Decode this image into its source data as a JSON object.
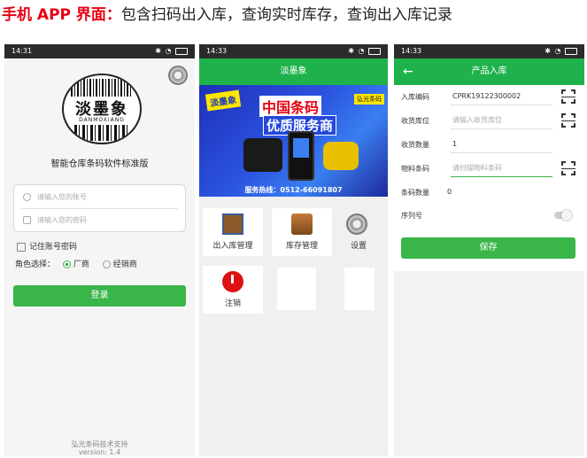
{
  "heading": {
    "prefix": "手机 APP 界面：",
    "text": "包含扫码出入库，查询实时库存，查询出入库记录"
  },
  "colors": {
    "accent_green": "#3ab54a",
    "title_green": "#1fb24c",
    "heading_red": "#e60012"
  },
  "phone1": {
    "status_time": "14:31",
    "logo_text": "淡墨象",
    "logo_sub": "DANMOXIANG",
    "app_name": "智能仓库条码软件标准版",
    "account_placeholder": "请输入您的账号",
    "password_placeholder": "请输入您的密码",
    "remember_label": "记住账号密码",
    "role_label": "角色选择：",
    "role_options": [
      "厂商",
      "经销商"
    ],
    "login_button": "登录",
    "footer_company": "弘光条码技术支持",
    "footer_version": "version: 1.4"
  },
  "phone2": {
    "status_time": "14:33",
    "title": "淡墨象",
    "banner": {
      "badge": "淡墨象",
      "tag": "弘光条码",
      "line1": "中国条码",
      "line2": "优质服务商",
      "hotline": "服务热线：0512-66091807"
    },
    "tiles": [
      "出入库管理",
      "库存管理",
      "设置",
      "注销"
    ]
  },
  "phone3": {
    "status_time": "14:33",
    "title": "产品入库",
    "fields": {
      "code_label": "入库编码",
      "code_value": "CPRK19122300002",
      "location_label": "收货库位",
      "location_placeholder": "请输入收货库位",
      "qty_label": "收货数量",
      "qty_value": "1",
      "barcode_label": "物料条码",
      "barcode_placeholder": "请扫描物料条码",
      "count_label": "条码数量",
      "count_value": "0",
      "serial_label": "序列号"
    },
    "save_button": "保存"
  }
}
